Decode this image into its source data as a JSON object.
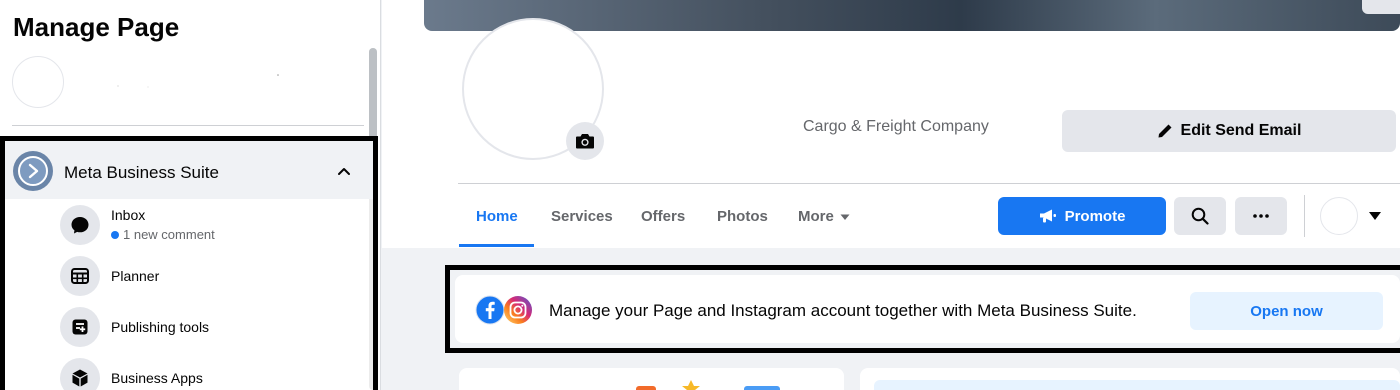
{
  "sidebar": {
    "title": "Manage Page",
    "suite": {
      "label": "Meta Business Suite",
      "logo_icon": "meta-business-suite-icon",
      "expanded": true
    },
    "items": [
      {
        "label": "Inbox",
        "icon": "chat-bubble-icon",
        "sub": "1 new comment"
      },
      {
        "label": "Planner",
        "icon": "calendar-grid-icon"
      },
      {
        "label": "Publishing tools",
        "icon": "publishing-tools-icon"
      },
      {
        "label": "Business Apps",
        "icon": "cube-icon"
      }
    ]
  },
  "profile": {
    "category": "Cargo & Freight Company",
    "edit_button": "Edit Send Email"
  },
  "tabs": [
    {
      "label": "Home",
      "active": true
    },
    {
      "label": "Services"
    },
    {
      "label": "Offers"
    },
    {
      "label": "Photos"
    },
    {
      "label": "More"
    }
  ],
  "actions": {
    "promote": "Promote"
  },
  "banner": {
    "text": "Manage your Page and Instagram account together with Meta Business Suite.",
    "button": "Open now"
  },
  "colors": {
    "accent": "#1877f2",
    "accent_light": "#e7f3ff",
    "background": "#f0f2f5",
    "button_gray": "#e4e6eb"
  }
}
